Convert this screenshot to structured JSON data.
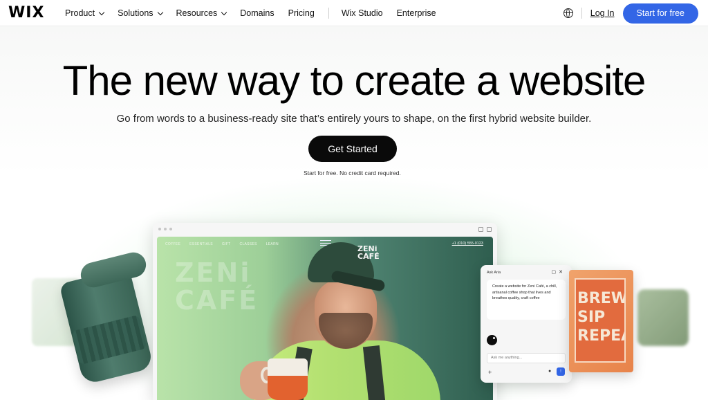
{
  "header": {
    "logo": "WIX",
    "nav": [
      {
        "label": "Product",
        "has_menu": true
      },
      {
        "label": "Solutions",
        "has_menu": true
      },
      {
        "label": "Resources",
        "has_menu": true
      },
      {
        "label": "Domains",
        "has_menu": false
      },
      {
        "label": "Pricing",
        "has_menu": false
      },
      {
        "label": "Wix Studio",
        "has_menu": false
      },
      {
        "label": "Enterprise",
        "has_menu": false
      }
    ],
    "language_icon": "globe-icon",
    "login_label": "Log In",
    "cta_label": "Start for free",
    "cta_color": "#3366e6"
  },
  "hero": {
    "headline": "The new way to create a website",
    "subhead": "Go from words to a business-ready site that’s entirely yours to shape, on the first hybrid website builder.",
    "cta_label": "Get Started",
    "note": "Start for free. No credit card required."
  },
  "showcase": {
    "site_nav": [
      "COFFEE",
      "ESSENTIALS",
      "GIFT",
      "CLASSES",
      "LEARN"
    ],
    "site_phone": "+1 (010) 555-0123",
    "site_title": "ZENi CAFÉ",
    "cap_logo": "ZENi CAFÉ",
    "chat": {
      "title": "Ask Aria",
      "message": "Create a website for Zeni Café, a chill, artisanal coffee shop that lives and breathes quality, craft coffee",
      "input_placeholder": "Ask me anything...",
      "plus": "+",
      "send": "↑"
    },
    "poster_text": "BREW SIP REPEAT"
  }
}
